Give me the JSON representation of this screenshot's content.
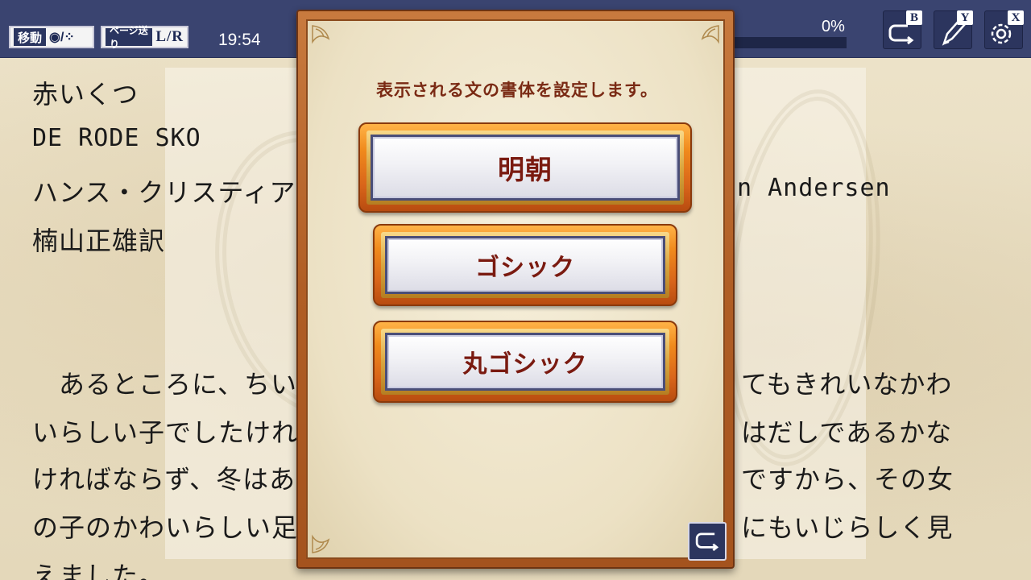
{
  "reading": {
    "lines": {
      "l1": "赤いくつ",
      "l2": "DE RODE SKO",
      "l3a": "ハンス・クリスティア",
      "l3b": "n Andersen",
      "l4": "楠山正雄訳",
      "p1a": "　あるところに、ちい",
      "p1b": "てもきれいなかわ",
      "p2a": "いらしい子でしたけれ",
      "p2b": "はだしであるかな",
      "p3a": "ければならず、冬はあ",
      "p3b": "ですから、その女",
      "p4a": "の子のかわいらしい足",
      "p4b": "にもいじらしく見",
      "p5a": "えました。"
    }
  },
  "topbar": {
    "move_tag": "移動",
    "move_glyph": "◉/⁘",
    "page_tag": "ページ送り",
    "page_keys": "L/R",
    "clock": "19:54",
    "progress_label": "0%",
    "progress_fraction": 0.0,
    "buttons": [
      {
        "key": "B",
        "icon": "return-icon"
      },
      {
        "key": "Y",
        "icon": "pen-icon"
      },
      {
        "key": "X",
        "icon": "gear-icon"
      }
    ]
  },
  "dialog": {
    "title": "表示される文の書体を設定します。",
    "options": [
      "明朝",
      "ゴシック",
      "丸ゴシック"
    ],
    "back_icon": "return-icon"
  },
  "colors": {
    "topbar": "#3a4470",
    "dialog_frame": "#b05e25",
    "option_text": "#7a1a10",
    "title_text": "#7a2a14"
  }
}
